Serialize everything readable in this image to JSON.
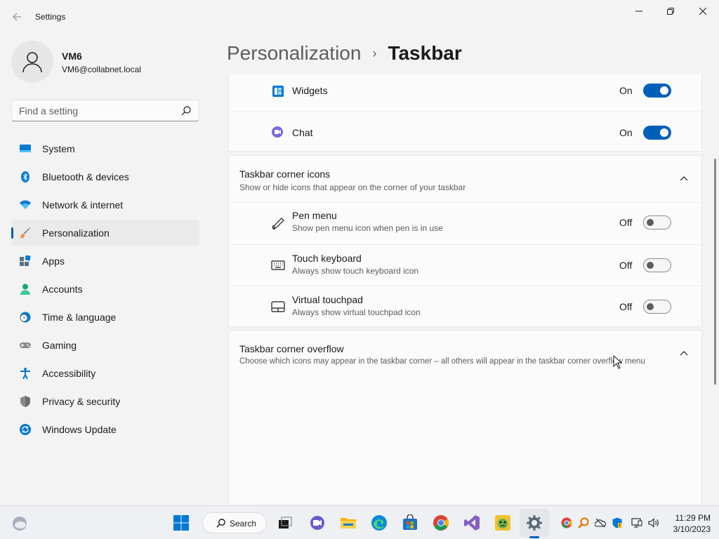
{
  "window": {
    "title": "Settings"
  },
  "profile": {
    "name": "VM6",
    "email": "VM6@collabnet.local"
  },
  "search": {
    "placeholder": "Find a setting"
  },
  "nav": {
    "items": [
      {
        "label": "System",
        "icon": "monitor-icon"
      },
      {
        "label": "Bluetooth & devices",
        "icon": "bluetooth-icon"
      },
      {
        "label": "Network & internet",
        "icon": "wifi-icon"
      },
      {
        "label": "Personalization",
        "icon": "paintbrush-icon",
        "active": true
      },
      {
        "label": "Apps",
        "icon": "apps-icon"
      },
      {
        "label": "Accounts",
        "icon": "person-icon"
      },
      {
        "label": "Time & language",
        "icon": "clock-globe-icon"
      },
      {
        "label": "Gaming",
        "icon": "gamepad-icon"
      },
      {
        "label": "Accessibility",
        "icon": "accessibility-icon"
      },
      {
        "label": "Privacy & security",
        "icon": "shield-icon"
      },
      {
        "label": "Windows Update",
        "icon": "update-icon"
      }
    ]
  },
  "breadcrumb": {
    "parent": "Personalization",
    "separator": "›",
    "current": "Taskbar"
  },
  "taskbar_items": {
    "rows": [
      {
        "title": "Widgets",
        "state": "On",
        "icon": "widgets-icon"
      },
      {
        "title": "Chat",
        "state": "On",
        "icon": "chat-icon"
      }
    ]
  },
  "corner_icons": {
    "title": "Taskbar corner icons",
    "description": "Show or hide icons that appear on the corner of your taskbar",
    "rows": [
      {
        "title": "Pen menu",
        "description": "Show pen menu icon when pen is in use",
        "state": "Off",
        "icon": "pen-icon"
      },
      {
        "title": "Touch keyboard",
        "description": "Always show touch keyboard icon",
        "state": "Off",
        "icon": "keyboard-icon"
      },
      {
        "title": "Virtual touchpad",
        "description": "Always show virtual touchpad icon",
        "state": "Off",
        "icon": "touchpad-icon"
      }
    ]
  },
  "corner_overflow": {
    "title": "Taskbar corner overflow",
    "description": "Choose which icons may appear in the taskbar corner – all others will appear in the taskbar corner overflow menu"
  },
  "taskbar": {
    "search_label": "Search",
    "time": "11:29 PM",
    "date": "3/10/2023"
  },
  "colors": {
    "accent": "#005fb8",
    "background": "#f3f3f3",
    "card": "#fbfbfb"
  }
}
